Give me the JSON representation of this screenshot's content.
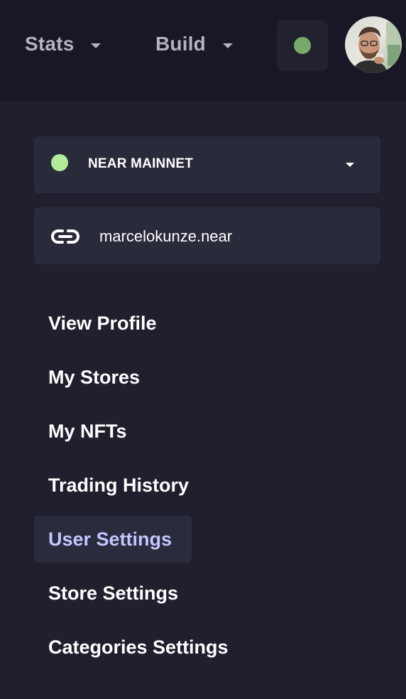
{
  "topbar": {
    "nav": [
      {
        "label": "Stats",
        "icon": "chevron-down-icon"
      },
      {
        "label": "Build",
        "icon": "chevron-down-icon"
      }
    ],
    "status_indicator": {
      "color": "#76a96a"
    },
    "avatar": {
      "icon": "user-avatar"
    }
  },
  "network": {
    "label": "NEAR MAINNET",
    "status_color": "#b4eb98",
    "icon": "chevron-down-icon"
  },
  "account": {
    "label": "marcelokunze.near",
    "icon": "link-icon"
  },
  "menu": {
    "items": [
      {
        "label": "View Profile",
        "active": false
      },
      {
        "label": "My Stores",
        "active": false
      },
      {
        "label": "My NFTs",
        "active": false
      },
      {
        "label": "Trading History",
        "active": false
      },
      {
        "label": "User Settings",
        "active": true
      },
      {
        "label": "Store Settings",
        "active": false
      },
      {
        "label": "Categories Settings",
        "active": false
      }
    ]
  },
  "colors": {
    "topbar_bg": "#171725",
    "panel_bg": "#1f1f2e",
    "card_bg": "#292a3a",
    "active_text": "#c2c7ff"
  }
}
